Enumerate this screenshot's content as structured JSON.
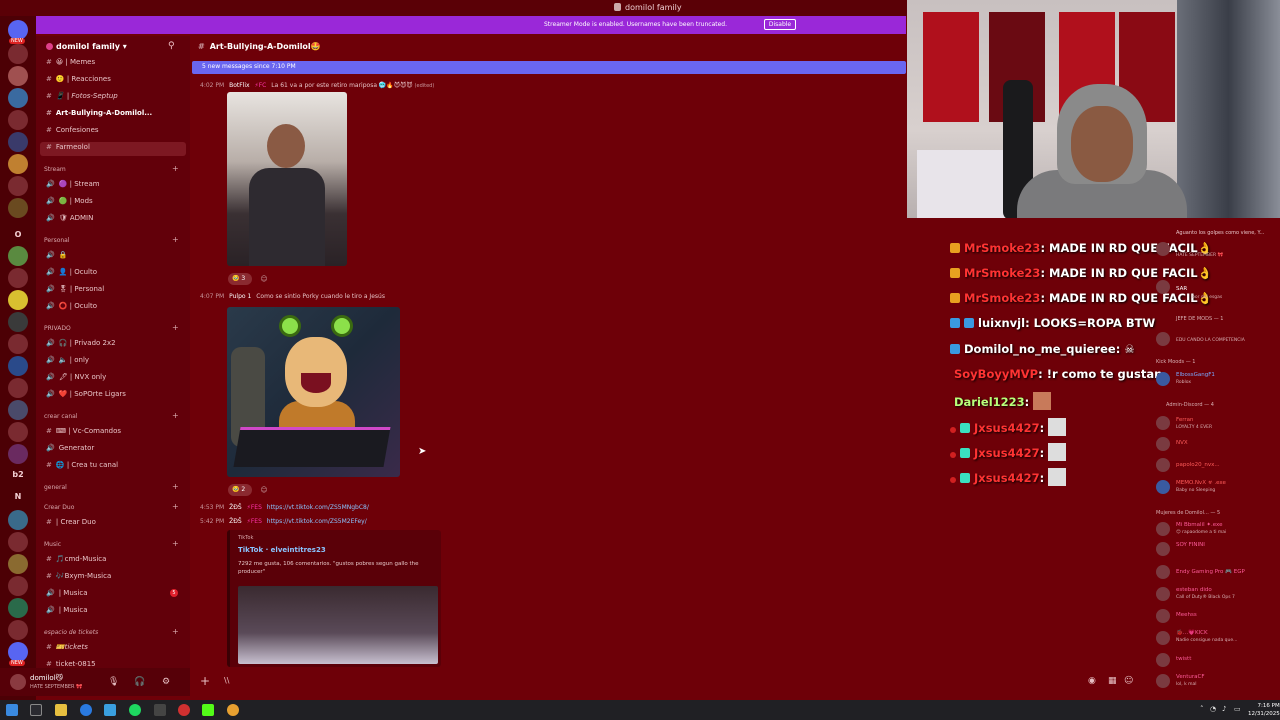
{
  "titlebar": {
    "title": "domilol family"
  },
  "streamer": {
    "notice": "Streamer Mode is enabled. Usernames have been truncated.",
    "disable_label": "Disable"
  },
  "server": {
    "name": "domilol family ▾"
  },
  "rail": {
    "letters": [
      "O",
      "N",
      "b2"
    ]
  },
  "channels": {
    "top": [
      {
        "label": "😀 | Memes"
      },
      {
        "label": "🙂 | Reacciones"
      },
      {
        "label": "📱 | Fotos-Septup"
      },
      {
        "label": "Art-Bullying-A-Domilol..."
      },
      {
        "label": "Confesiones"
      },
      {
        "label": "Farmeolol"
      }
    ],
    "stream_cat": "Stream",
    "stream": [
      {
        "label": "🟣 | Stream"
      },
      {
        "label": "🟢 | Mods"
      },
      {
        "label": "🛡 ADMIN"
      }
    ],
    "personal_cat": "Personal",
    "personal": [
      {
        "label": "🔒"
      },
      {
        "label": "👤 | Oculto"
      },
      {
        "label": "🎖 | Personal"
      },
      {
        "label": "⭕ | Oculto"
      }
    ],
    "privado_cat": "PRIVADO",
    "privado": [
      {
        "label": "🎧 | Privado 2x2"
      },
      {
        "label": "🔈 | only"
      },
      {
        "label": "🖋 | NVX only"
      },
      {
        "label": "❤️ | SoPOrte Ligars"
      }
    ],
    "crear_cat": "crear canal",
    "crear": [
      {
        "label": "⌨ | Vc-Comandos"
      },
      {
        "label": "Generator"
      },
      {
        "label": "🌐 | Crea tu canal"
      }
    ],
    "general_cat": "general",
    "creardue_cat": "Crear Duo",
    "creardue": [
      {
        "label": "| Crear Duo"
      }
    ],
    "music_cat": "Music",
    "music": [
      {
        "label": "🎵cmd-Musica"
      },
      {
        "label": "🎶Bxym-Musica"
      },
      {
        "label": "| Musica"
      },
      {
        "label": "| Musica"
      }
    ],
    "tickets_cat": "espacio de tickets",
    "tickets": [
      {
        "label": "🎫tickets"
      },
      {
        "label": "ticket-0815"
      }
    ],
    "badge": "5"
  },
  "user": {
    "name": "domilol😼",
    "status": "HATE SEPTEMBER 🎀"
  },
  "chat": {
    "channel_title": "Art-Bullying-A-Domilol🤩",
    "new_messages": "5 new messages since 7:10 PM",
    "msg1": {
      "time": "4:02 PM",
      "user": "BotFlix",
      "tag": "⚡FC",
      "text": "La 61 va a por este retiro mariposa 🥶🔥😈😈😈",
      "edited": "(edited)"
    },
    "react1": {
      "emoji": "🥹",
      "count": "3"
    },
    "msg2": {
      "time": "4:07 PM",
      "user": "Pulpo 1",
      "text": "Como se sintio Porky cuando le tiro a Jesús"
    },
    "react2": {
      "emoji": "🥹",
      "count": "2"
    },
    "msg3": {
      "time": "4:53 PM",
      "user": "ŽĐŠ",
      "tag": "⚡FES",
      "link": "https://vt.tiktok.com/ZS5MNgbC8/"
    },
    "msg4": {
      "time": "5:42 PM",
      "user": "ŽĐŠ",
      "tag": "⚡FES",
      "link": "https://vt.tiktok.com/ZS5M2EFey/"
    },
    "embed": {
      "provider": "TikTok",
      "title": "TikTok · elveintitres23",
      "description": "7292 me gusta, 106 comentarios. \"gustos pobres segun gallo the producer\""
    },
    "composer_cursor": "\\\\"
  },
  "overlay": [
    {
      "user": "MrSmoke23",
      "msg": ": MADE IN RD QUE FACIL👌",
      "color": "#ff3b3b"
    },
    {
      "user": "MrSmoke23",
      "msg": ": MADE IN RD QUE FACIL👌",
      "color": "#ff3b3b"
    },
    {
      "user": "MrSmoke23",
      "msg": ": MADE IN RD QUE FACIL👌",
      "color": "#ff3b3b"
    },
    {
      "user": "luixnvjl",
      "msg": ": LOOKS=ROPA BTW",
      "color": "#ffffff"
    },
    {
      "user": "Domilol_no_me_quieree",
      "msg": ": ☠",
      "color": "#ffffff"
    },
    {
      "user": "SoyBoyyMVP",
      "msg": ": !r como te gustan",
      "color": "#ff3b3b"
    },
    {
      "user": "Dariel1223",
      "msg": ":",
      "color": "#b8ff7a"
    },
    {
      "user": "Jxsus4427",
      "msg": ":",
      "color": "#ff3b3b"
    },
    {
      "user": "Jxsus4427",
      "msg": ":",
      "color": "#ff3b3b"
    },
    {
      "user": "Jxsus4427",
      "msg": ":",
      "color": "#ff3b3b"
    }
  ],
  "kick": {
    "top_note": "Aguanto los golpes como viene, Y...",
    "r1_sub": "HATE SEPTEMBER 🎀",
    "r2_nm": "SAR",
    "r2_sub": "bor del esgas",
    "h1": "JEFE DE MODS — 1",
    "r3_sub": "EDU CANDO LA COMPETENCIA",
    "h2": "Kick Moods — 1",
    "r4_nm": "ElbossGangF1",
    "r4_sub": "Roblox",
    "h3": "Admin-Discord — 4",
    "r5_nm": "Ferran",
    "r5_sub": "LOYALTY 4 EVER",
    "r6_nm": "NVX",
    "r7_nm": "papolo20_nvx...",
    "r8_nm": "MEMO.NvX ☣ .exe",
    "r8_sub": "Baby no Sleeping",
    "h4": "Mujeres de Domilol... — 5",
    "r9_nm": "Mi Bbmalil ✦.exe",
    "r9_sub": "😊 rapaodome a ti mai",
    "r10_nm": "SOY FININI",
    "r11_nm": "Endy Gaming Pro 🎮 EGP",
    "r12_nm": "esteban dido",
    "r12_sub": "Call of Duty® Black Ops 7",
    "r13_nm": "Meehss",
    "r14_nm": "🐞...💗KICK",
    "r14_sub": "Nadie consigue nada que...",
    "r15_nm": "twistt",
    "r16_nm": "VenturaCF",
    "r16_sub": "lol, k mal"
  },
  "clock": {
    "time": "7:16 PM",
    "date": "12/31/2025"
  }
}
